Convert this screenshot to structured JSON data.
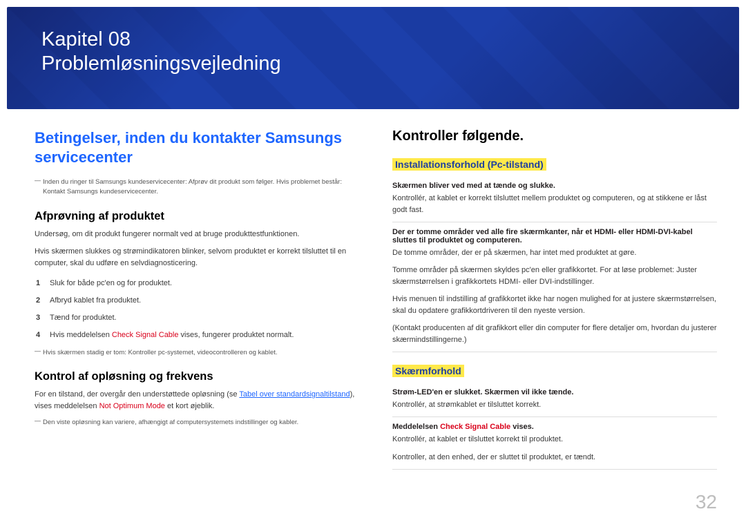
{
  "banner": {
    "chapter": "Kapitel 08",
    "title": "Problemløsningsvejledning"
  },
  "left": {
    "h2": "Betingelser, inden du kontakter Samsungs servicecenter",
    "note1": "Inden du ringer til Samsungs kundeservicecenter: Afprøv dit produkt som følger. Hvis problemet består: Kontakt Samsungs kundeservicecenter.",
    "h3a": "Afprøvning af produktet",
    "p1": "Undersøg, om dit produkt fungerer normalt ved at bruge produkttestfunktionen.",
    "p2": "Hvis skærmen slukkes og strømindikatoren blinker, selvom produktet er korrekt tilsluttet til en computer, skal du udføre en selvdiagnosticering.",
    "steps": [
      "Sluk for både pc'en og for produktet.",
      "Afbryd kablet fra produktet.",
      "Tænd for produktet.",
      "Hvis meddelelsen Check Signal Cable vises, fungerer produktet normalt."
    ],
    "step4_prefix": "Hvis meddelelsen ",
    "step4_red": "Check Signal Cable",
    "step4_suffix": " vises, fungerer produktet normalt.",
    "note2": "Hvis skærmen stadig er tom: Kontroller pc-systemet, videocontrolleren og kablet.",
    "h3b": "Kontrol af opløsning og frekvens",
    "p3_a": "For en tilstand, der overgår den understøttede opløsning (se ",
    "p3_link": "Tabel over standardsignaltilstand",
    "p3_b": "), vises meddelelsen ",
    "p3_red": "Not Optimum Mode",
    "p3_c": " et kort øjeblik.",
    "note3": "Den viste opløsning kan variere, afhængigt af computersystemets indstillinger og kabler."
  },
  "right": {
    "h2": "Kontroller følgende.",
    "h4a": "Installationsforhold (Pc-tilstand)",
    "b1": "Skærmen bliver ved med at tænde og slukke.",
    "r1": "Kontrollér, at kablet er korrekt tilsluttet mellem produktet og computeren, og at stikkene er låst godt fast.",
    "b2": "Der er tomme områder ved alle fire skærmkanter, når et HDMI- eller HDMI-DVI-kabel sluttes til produktet og computeren.",
    "r2a": "De tomme områder, der er på skærmen, har intet med produktet at gøre.",
    "r2b": "Tomme områder på skærmen skyldes pc'en eller grafikkortet. For at løse problemet: Juster skærmstørrelsen i grafikkortets HDMI- eller DVI-indstillinger.",
    "r2c": "Hvis menuen til indstilling af grafikkortet ikke har nogen mulighed for at justere skærmstørrelsen, skal du opdatere grafikkortdriveren til den nyeste version.",
    "r2d": "(Kontakt producenten af dit grafikkort eller din computer for flere detaljer om, hvordan du justerer skærmindstillingerne.)",
    "h4b": "Skærmforhold",
    "b3": "Strøm-LED'en er slukket. Skærmen vil ikke tænde.",
    "r3": "Kontrollér, at strømkablet er tilsluttet korrekt.",
    "b4_a": "Meddelelsen ",
    "b4_red": "Check Signal Cable",
    "b4_b": " vises.",
    "r4a": "Kontrollér, at kablet er tilsluttet korrekt til produktet.",
    "r4b": "Kontroller, at den enhed, der er sluttet til produktet, er tændt."
  },
  "page_number": "32"
}
